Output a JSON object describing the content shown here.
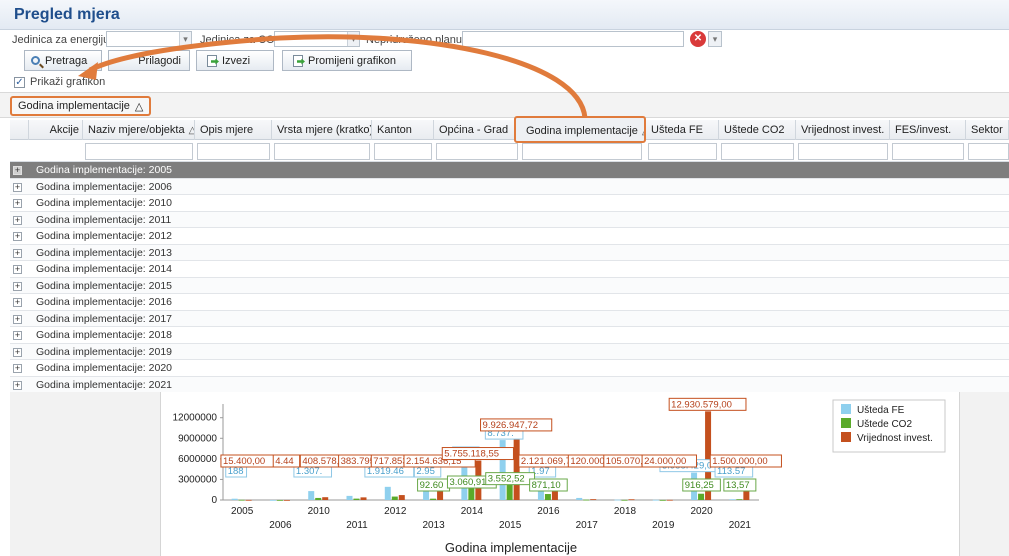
{
  "title": "Pregled mjera",
  "filters": {
    "energy_unit_label": "Jedinica za energiju",
    "co2_unit_label": "Jedinica za CO2",
    "unassigned_label": "Nepridruženo planu:"
  },
  "toolbar": {
    "search": "Pretraga",
    "customize": "Prilagodi",
    "export": "Izvezi",
    "change_chart": "Promijeni grafikon"
  },
  "show_chart_label": "Prikaži grafikon",
  "show_chart_checked": true,
  "group_chip": "Godina implementacije",
  "sort_icon": "△",
  "columns": [
    "Akcije",
    "Naziv mjere/objekta",
    "Opis mjere",
    "Vrsta mjere (kratko)",
    "Kanton",
    "Općina - Grad",
    "Godina implementacije",
    "Ušteda FE",
    "Uštede CO2",
    "Vrijednost invest.",
    "FES/invest.",
    "Sektor"
  ],
  "groups": [
    "Godina implementacije: 2005",
    "Godina implementacije: 2006",
    "Godina implementacije: 2010",
    "Godina implementacije: 2011",
    "Godina implementacije: 2012",
    "Godina implementacije: 2013",
    "Godina implementacije: 2014",
    "Godina implementacije: 2015",
    "Godina implementacije: 2016",
    "Godina implementacije: 2017",
    "Godina implementacije: 2018",
    "Godina implementacije: 2019",
    "Godina implementacije: 2020",
    "Godina implementacije: 2021"
  ],
  "colors": {
    "accent": "#e07b3c",
    "title": "#1f4e8c",
    "selected_row": "#7e7e7e",
    "fe": "#8fd0ee",
    "co2": "#5aaa2a",
    "invest": "#c4501e"
  },
  "chart_data": {
    "type": "bar",
    "xlabel": "Godina implementacije",
    "categories": [
      "2005",
      "2006",
      "2010",
      "2011",
      "2012",
      "2013",
      "2014",
      "2015",
      "2016",
      "2017",
      "2018",
      "2019",
      "2020",
      "2021"
    ],
    "yticks": [
      "12000000",
      "9000000",
      "6000000",
      "3000000",
      "0"
    ],
    "ylim": [
      0,
      14000000
    ],
    "legend_position": "top-right",
    "series": [
      {
        "name": "Ušteda FE",
        "values": [
          188000,
          5000,
          1300000,
          600000,
          1919460,
          2950000,
          5840000,
          8737000,
          1970000,
          300000,
          50000,
          30000,
          3988429.04,
          113570
        ],
        "labels": [
          "188",
          "",
          "1.307.",
          "",
          "1.919.46",
          "2.95",
          "5.84",
          "8.737.",
          "1.97",
          "",
          "",
          "",
          "3.988.429,04",
          "113.57"
        ]
      },
      {
        "name": "Uštede CO2",
        "values": [
          30000,
          5000,
          300000,
          200000,
          500000,
          192600,
          3060910,
          3552520,
          871100,
          50000,
          20000,
          10000,
          916250,
          113570
        ],
        "labels": [
          "",
          "",
          "",
          "",
          "",
          "92.60",
          "3.060,91",
          "3.552,52",
          "871,10",
          "",
          "",
          "",
          "916,25",
          "13,57"
        ]
      },
      {
        "name": "Vrijednost invest.",
        "values": [
          15400,
          4440,
          408578,
          383795,
          717853.61,
          2154636.15,
          5755118.55,
          9926947.72,
          2121069.79,
          120000,
          105070,
          24000,
          12930579,
          1500000
        ],
        "labels": [
          "15.400,00",
          "4.44",
          "408.578,",
          "383.795,",
          "717.853,61",
          "2.154.636,15",
          "5.755.118,55",
          "9.926.947,72",
          "2.121.069,79",
          "120.000,",
          "105.070,0",
          "24.000,00",
          "12.930.579,00",
          "1.500.000,00"
        ]
      }
    ]
  }
}
